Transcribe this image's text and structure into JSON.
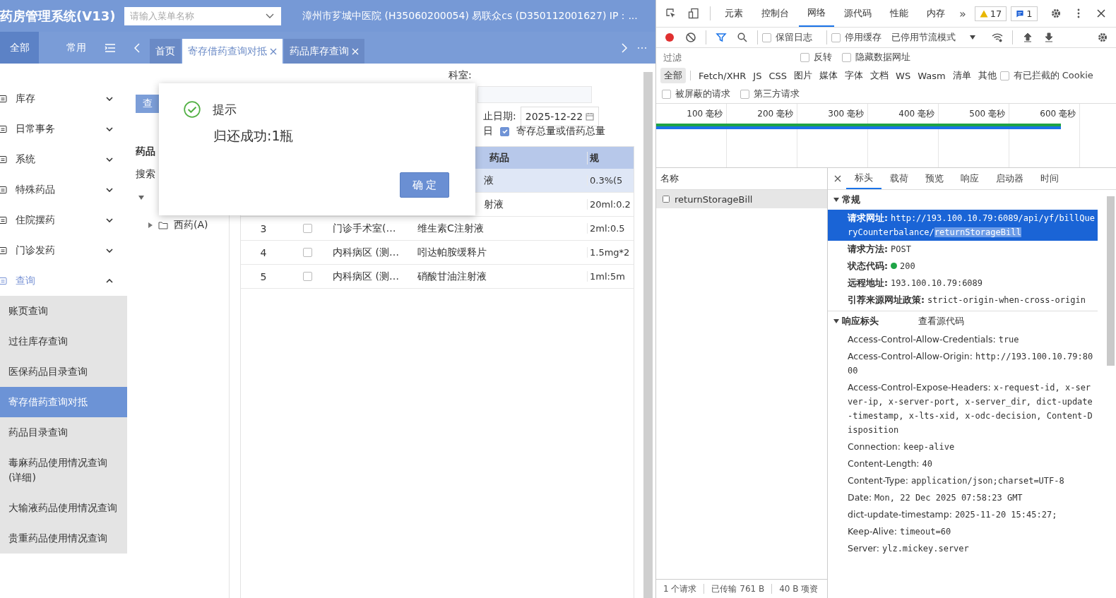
{
  "app": {
    "title": "药房管理系统(V13)",
    "menu_search": {
      "placeholder": "请输入菜单名称"
    },
    "org_info": "漳州市芗城中医院 (H35060200054) 易联众cs (D350112001627) IP：...",
    "sidebar_tabs": [
      {
        "label": "全部",
        "selected": true
      },
      {
        "label": "常用",
        "selected": false
      }
    ],
    "page_tabs": [
      {
        "label": "首页",
        "selected": false,
        "closable": false
      },
      {
        "label": "寄存借药查询对抵",
        "selected": true,
        "closable": true
      },
      {
        "label": "药品库存查询",
        "selected": false,
        "closable": true
      }
    ],
    "menu": [
      {
        "label": "库存",
        "expanded": false
      },
      {
        "label": "日常事务",
        "expanded": false
      },
      {
        "label": "系统",
        "expanded": false
      },
      {
        "label": "特殊药品",
        "expanded": false
      },
      {
        "label": "住院摆药",
        "expanded": false
      },
      {
        "label": "门诊发药",
        "expanded": false
      },
      {
        "label": "查询",
        "expanded": true,
        "children": [
          {
            "label": "账页查询",
            "selected": false
          },
          {
            "label": "过往库存查询",
            "selected": false
          },
          {
            "label": "医保药品目录查询",
            "selected": false
          },
          {
            "label": "寄存借药查询对抵",
            "selected": true
          },
          {
            "label": "药品目录查询",
            "selected": false
          },
          {
            "label": "毒麻药品使用情况查询(详细)",
            "selected": false
          },
          {
            "label": "大输液药品使用情况查询",
            "selected": false
          },
          {
            "label": "贵重药品使用情况查询",
            "selected": false
          }
        ]
      }
    ],
    "filters": {
      "dept_label": "科室:",
      "query_button": "查",
      "date_label": "止日期:",
      "date_value": "2025-12-22",
      "partial_label": "日",
      "total_checkbox": {
        "label": "寄存总量或借药总量",
        "checked": true
      }
    },
    "tree_panel": {
      "title": "药品",
      "search_label": "搜索",
      "nodes": [
        {
          "label": "西药(A)",
          "expanded": false
        }
      ]
    },
    "table": {
      "header": {
        "drug": "药品",
        "spec": "规"
      },
      "rows": [
        {
          "kind": "covered",
          "selected": true,
          "drug": "液",
          "spec": "0.3%(5"
        },
        {
          "kind": "covered",
          "selected": false,
          "drug": "射液",
          "spec": "20ml:0.2"
        },
        {
          "kind": "full",
          "selected": false,
          "no": "3",
          "checked": false,
          "dept": "门诊手术室(…",
          "drug": "维生素C注射液",
          "spec": "2ml:0.5"
        },
        {
          "kind": "full",
          "selected": false,
          "no": "4",
          "checked": false,
          "dept": "内科病区 (测…",
          "drug": "吲达帕胺缓释片",
          "spec": "1.5mg*2"
        },
        {
          "kind": "full",
          "selected": false,
          "no": "5",
          "checked": false,
          "dept": "内科病区 (测…",
          "drug": "硝酸甘油注射液",
          "spec": "1ml:5m"
        }
      ]
    },
    "dialog": {
      "title": "提示",
      "message": "归还成功:1瓶",
      "ok_button": "确 定"
    }
  },
  "devtools": {
    "panel_tabs": [
      {
        "label": "元素",
        "selected": false
      },
      {
        "label": "控制台",
        "selected": false
      },
      {
        "label": "网络",
        "selected": true
      },
      {
        "label": "源代码",
        "selected": false
      },
      {
        "label": "性能",
        "selected": false
      },
      {
        "label": "内存",
        "selected": false
      }
    ],
    "more": "»",
    "warnings": "17",
    "messages": "1",
    "toolbar": {
      "recording": true,
      "preserve_log": {
        "label": "保留日志",
        "checked": false
      },
      "disable_cache": {
        "label": "停用缓存",
        "checked": false
      },
      "throttling": "已停用节流模式"
    },
    "filter": {
      "placeholder": "过滤",
      "invert": {
        "label": "反转",
        "checked": false
      },
      "hide_data_urls": {
        "label": "隐藏数据网址",
        "checked": false
      }
    },
    "type_filters": [
      {
        "label": "全部",
        "selected": true
      },
      {
        "label": "Fetch/XHR",
        "selected": false
      },
      {
        "label": "JS",
        "selected": false
      },
      {
        "label": "CSS",
        "selected": false
      },
      {
        "label": "图片",
        "selected": false
      },
      {
        "label": "媒体",
        "selected": false
      },
      {
        "label": "字体",
        "selected": false
      },
      {
        "label": "文档",
        "selected": false
      },
      {
        "label": "WS",
        "selected": false
      },
      {
        "label": "Wasm",
        "selected": false
      },
      {
        "label": "清单",
        "selected": false
      },
      {
        "label": "其他",
        "selected": false
      }
    ],
    "blocked_cookies": {
      "label": "有已拦截的 Cookie",
      "checked": false
    },
    "more_filters": [
      {
        "label": "被屏蔽的请求",
        "checked": false
      },
      {
        "label": "第三方请求",
        "checked": false
      }
    ],
    "timeline_ticks": [
      "100 毫秒",
      "200 毫秒",
      "300 毫秒",
      "400 毫秒",
      "500 毫秒",
      "600 毫秒"
    ],
    "requests": {
      "header": "名称",
      "rows": [
        {
          "name": "returnStorageBill",
          "selected": true
        }
      ]
    },
    "status": [
      "1 个请求",
      "已传输 761 B",
      "40 B 项资"
    ],
    "detail_tabs": [
      {
        "label": "标头",
        "selected": true
      },
      {
        "label": "载荷",
        "selected": false
      },
      {
        "label": "预览",
        "selected": false
      },
      {
        "label": "响应",
        "selected": false
      },
      {
        "label": "启动器",
        "selected": false
      },
      {
        "label": "时间",
        "selected": false
      }
    ],
    "general": {
      "title": "常规",
      "expanded": true,
      "rows": [
        {
          "kind": "url",
          "selected": true,
          "key": "请求网址:",
          "value": "http://193.100.10.79:6089/api/yf/billQueryCounterbalance/",
          "value_selected": "returnStorageBill"
        },
        {
          "kind": "text",
          "selected": false,
          "key": "请求方法:",
          "value": "POST"
        },
        {
          "kind": "status",
          "selected": false,
          "key": "状态代码:",
          "value": "200"
        },
        {
          "kind": "text",
          "selected": false,
          "key": "远程地址:",
          "value": "193.100.10.79:6089"
        },
        {
          "kind": "text",
          "selected": false,
          "key": "引荐来源网址政策:",
          "value": "strict-origin-when-cross-origin"
        }
      ]
    },
    "response_headers": {
      "title": "响应标头",
      "expanded": true,
      "view_source": "查看源代码",
      "rows": [
        {
          "key": "Access-Control-Allow-Credentials:",
          "value": "true"
        },
        {
          "key": "Access-Control-Allow-Origin:",
          "value": "http://193.100.10.79:8000"
        },
        {
          "key": "Access-Control-Expose-Headers:",
          "value": "x-request-id, x-server-ip, x-server-port, x-server_dir, dict-update-timestamp, x-lts-xid, x-odc-decision, Content-Disposition"
        },
        {
          "key": "Connection:",
          "value": "keep-alive"
        },
        {
          "key": "Content-Length:",
          "value": "40"
        },
        {
          "key": "Content-Type:",
          "value": "application/json;charset=UTF-8"
        },
        {
          "key": "Date:",
          "value": "Mon, 22 Dec 2025 07:58:23 GMT"
        },
        {
          "key": "dict-update-timestamp:",
          "value": "2025-11-20 15:45:27;"
        },
        {
          "key": "Keep-Alive:",
          "value": "timeout=60"
        },
        {
          "key": "Server:",
          "value": "ylz.mickey.server"
        }
      ]
    }
  }
}
